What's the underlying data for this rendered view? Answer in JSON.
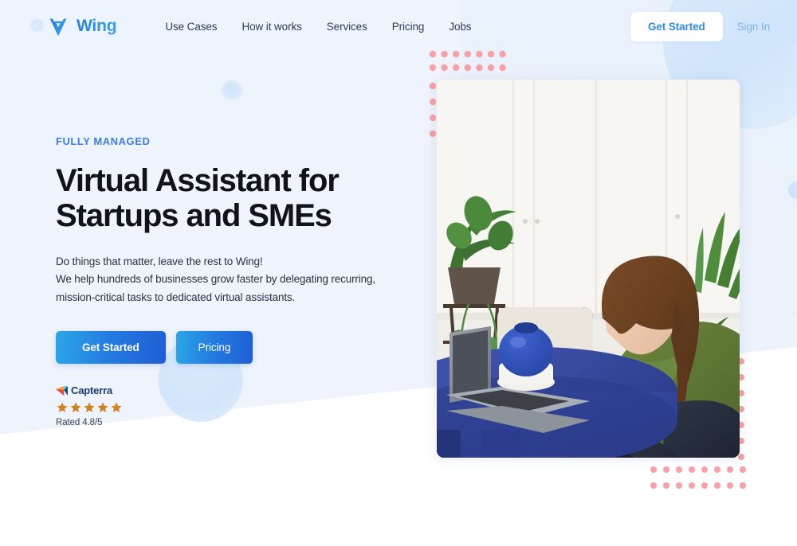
{
  "brand": {
    "name": "Wing",
    "logo_icon": "wing-w-logo-icon",
    "accent_color": "#2f8de8"
  },
  "nav": {
    "links": [
      {
        "label": "Use Cases"
      },
      {
        "label": "How it works"
      },
      {
        "label": "Services"
      },
      {
        "label": "Pricing"
      },
      {
        "label": "Jobs"
      }
    ],
    "get_started_label": "Get Started",
    "sign_in_label": "Sign In"
  },
  "hero": {
    "eyebrow": "FULLY MANAGED",
    "title_line1": "Virtual Assistant for",
    "title_line2": "Startups and SMEs",
    "sub_line1": "Do things that matter, leave the rest to Wing!",
    "sub_line2": "We help hundreds of businesses grow faster by delegating recurring,",
    "sub_line3": "mission-critical tasks to dedicated virtual assistants.",
    "cta_primary_label": "Get Started",
    "cta_secondary_label": "Pricing",
    "title_color": "#111318",
    "eyebrow_color": "#3f7ce8",
    "cta_gradient_from": "#2ba6e7",
    "cta_gradient_to": "#1f5ed6"
  },
  "rating": {
    "source_name": "Capterra",
    "source_icon": "capterra-arrow-icon",
    "stars_filled": 5,
    "star_color": "#d08325",
    "rating_text": "Rated 4.8/5",
    "score": 4.8,
    "scale": 5
  },
  "photo": {
    "alt": "Woman in green turtleneck sweater working on a laptop at a blue round table while holding a phone, with houseplants behind her"
  },
  "decor": {
    "dot_color": "#f8a0a8",
    "circle_color": "#d3e6fb",
    "background_color": "#eef4fd"
  }
}
